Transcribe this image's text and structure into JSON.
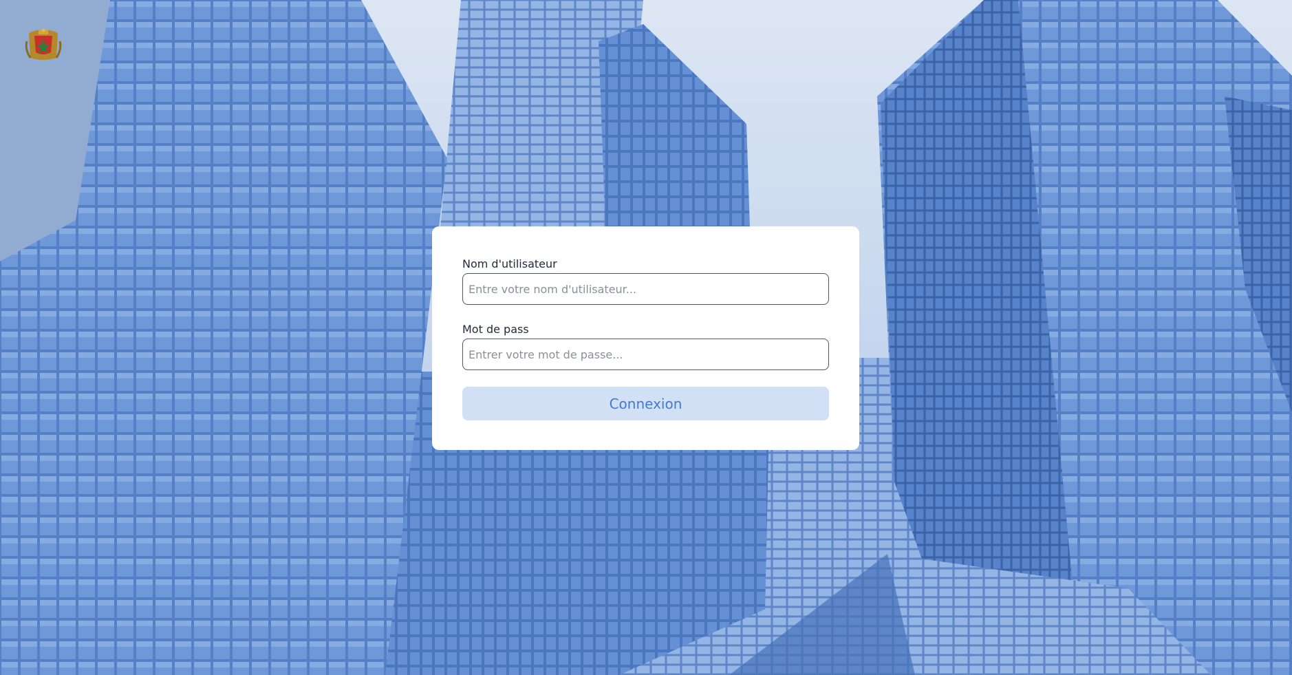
{
  "header": {
    "emblem_icon": "royal-coat-of-arms-icon"
  },
  "login_form": {
    "username_label": "Nom d'utilisateur",
    "username_placeholder": "Entre votre nom d'utilisateur...",
    "username_value": "",
    "password_label": "Mot de pass",
    "password_placeholder": "Entrer votre mot de passe...",
    "password_value": "",
    "submit_label": "Connexion"
  },
  "colors": {
    "card_background": "#ffffff",
    "button_background": "#d2e0f5",
    "button_text": "#3f7ad3",
    "background_sky": "#c9d8ee",
    "background_glass": "#3563ad"
  }
}
